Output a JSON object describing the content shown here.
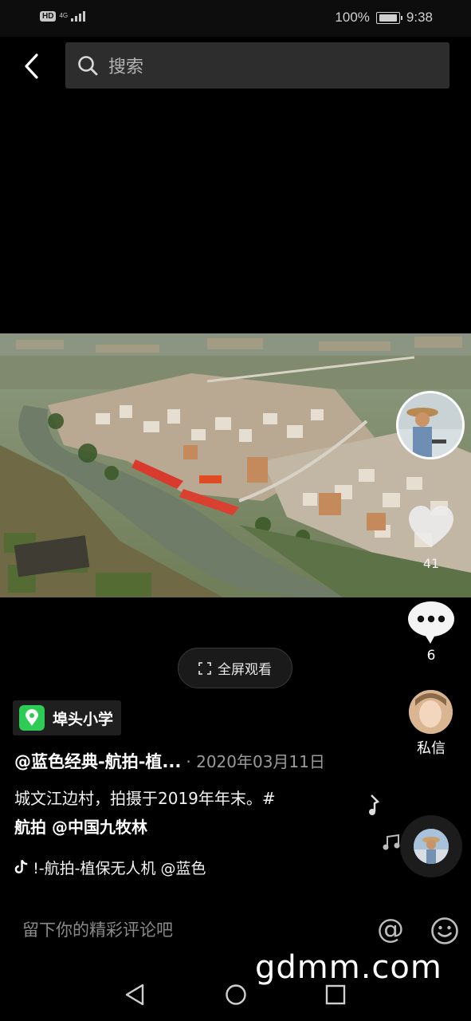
{
  "status_bar": {
    "network_badge": "HD",
    "network_type": "4G",
    "battery_percent": "100%",
    "time": "9:38"
  },
  "search": {
    "placeholder": "搜索"
  },
  "sidebar": {
    "like_count": "41",
    "comment_count": "6",
    "dm_label": "私信"
  },
  "player": {
    "fullscreen_label": "全屏观看"
  },
  "post": {
    "location": "埠头小学",
    "author": "@蓝色经典-航拍-植...",
    "date": "· 2020年03月11日",
    "description_line1": "城文江边村，拍摄于2019年年末。#",
    "description_line2": "航拍 @中国九牧林",
    "music": "!-航拍-植保无人机    @蓝色"
  },
  "comment_box": {
    "placeholder": "留下你的精彩评论吧"
  },
  "watermark": "gdmm.com",
  "icons": {
    "back": "chevron-left-icon",
    "search": "search-icon",
    "like": "heart-icon",
    "comment": "speech-bubble-icon",
    "location": "map-pin-icon",
    "music": "tiktok-note-icon",
    "at": "at-sign-icon",
    "emoji": "smiley-icon"
  }
}
